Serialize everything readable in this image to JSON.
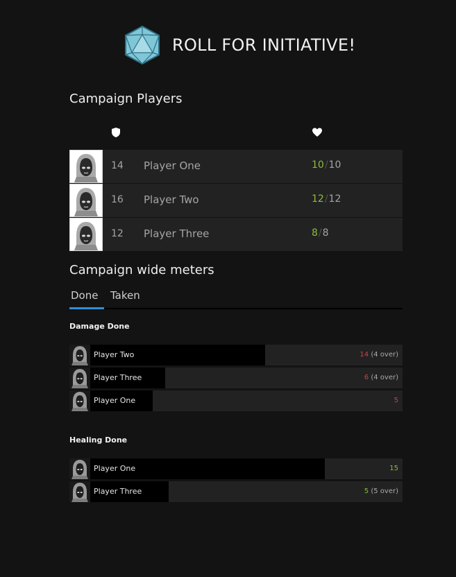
{
  "header": {
    "title": "ROLL FOR INITIATIVE!",
    "logo_icon": "d20-dice-icon"
  },
  "players_section": {
    "title": "Campaign Players",
    "columns": {
      "initiative_icon": "shield-icon",
      "health_icon": "heart-icon"
    },
    "rows": [
      {
        "initiative": "14",
        "name": "Player One",
        "hp_current": "10",
        "hp_max": "10"
      },
      {
        "initiative": "16",
        "name": "Player Two",
        "hp_current": "12",
        "hp_max": "12"
      },
      {
        "initiative": "12",
        "name": "Player Three",
        "hp_current": "8",
        "hp_max": "8"
      }
    ]
  },
  "meters_section": {
    "title": "Campaign wide meters",
    "tabs": [
      {
        "label": "Done",
        "active": true
      },
      {
        "label": "Taken",
        "active": false
      }
    ]
  },
  "damage_done": {
    "title": "Damage Done",
    "rows": [
      {
        "name": "Player Two",
        "value": "14",
        "extra": "(4 over)",
        "fraction": 0.56
      },
      {
        "name": "Player Three",
        "value": "6",
        "extra": "(4 over)",
        "fraction": 0.24
      },
      {
        "name": "Player One",
        "value": "5",
        "extra": "",
        "fraction": 0.2
      }
    ]
  },
  "healing_done": {
    "title": "Healing Done",
    "rows": [
      {
        "name": "Player One",
        "value": "15",
        "extra": "",
        "fraction": 0.75
      },
      {
        "name": "Player Three",
        "value": "5",
        "extra": "(5 over)",
        "fraction": 0.25
      }
    ]
  },
  "colors": {
    "background": "#131313",
    "row_background": "#222222",
    "hp_current": "#8bbf3a",
    "damage": "#c0474a",
    "healing": "#8bbf3a",
    "tab_accent": "#2f8fd8"
  }
}
